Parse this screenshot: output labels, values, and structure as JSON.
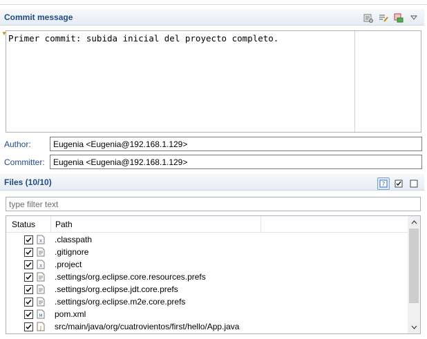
{
  "commit": {
    "title": "Commit message",
    "message": "Primer commit: subida inicial del proyecto completo."
  },
  "author": {
    "label": "Author:",
    "value": "Eugenia <Eugenia@192.168.1.129>"
  },
  "committer": {
    "label": "Committer:",
    "value": "Eugenia <Eugenia@192.168.1.129>"
  },
  "files": {
    "title": "Files (10/10)",
    "filter_placeholder": "type filter text",
    "columns": {
      "status": "Status",
      "path": "Path"
    },
    "rows": [
      {
        "path": ".classpath",
        "icon": "xml-file-icon",
        "checked": true
      },
      {
        "path": ".gitignore",
        "icon": "text-file-icon",
        "checked": true
      },
      {
        "path": ".project",
        "icon": "xml-file-icon",
        "checked": true
      },
      {
        "path": ".settings/org.eclipse.core.resources.prefs",
        "icon": "text-file-icon",
        "checked": true
      },
      {
        "path": ".settings/org.eclipse.jdt.core.prefs",
        "icon": "text-file-icon",
        "checked": true
      },
      {
        "path": ".settings/org.eclipse.m2e.core.prefs",
        "icon": "text-file-icon",
        "checked": true
      },
      {
        "path": "pom.xml",
        "icon": "maven-pom-icon",
        "checked": true
      },
      {
        "path": "src/main/java/org/cuatrovientos/first/hello/App.java",
        "icon": "java-file-icon",
        "checked": true
      }
    ]
  },
  "colors": {
    "header_text": "#1f4a82",
    "header_bg": "#e6ecf4"
  }
}
